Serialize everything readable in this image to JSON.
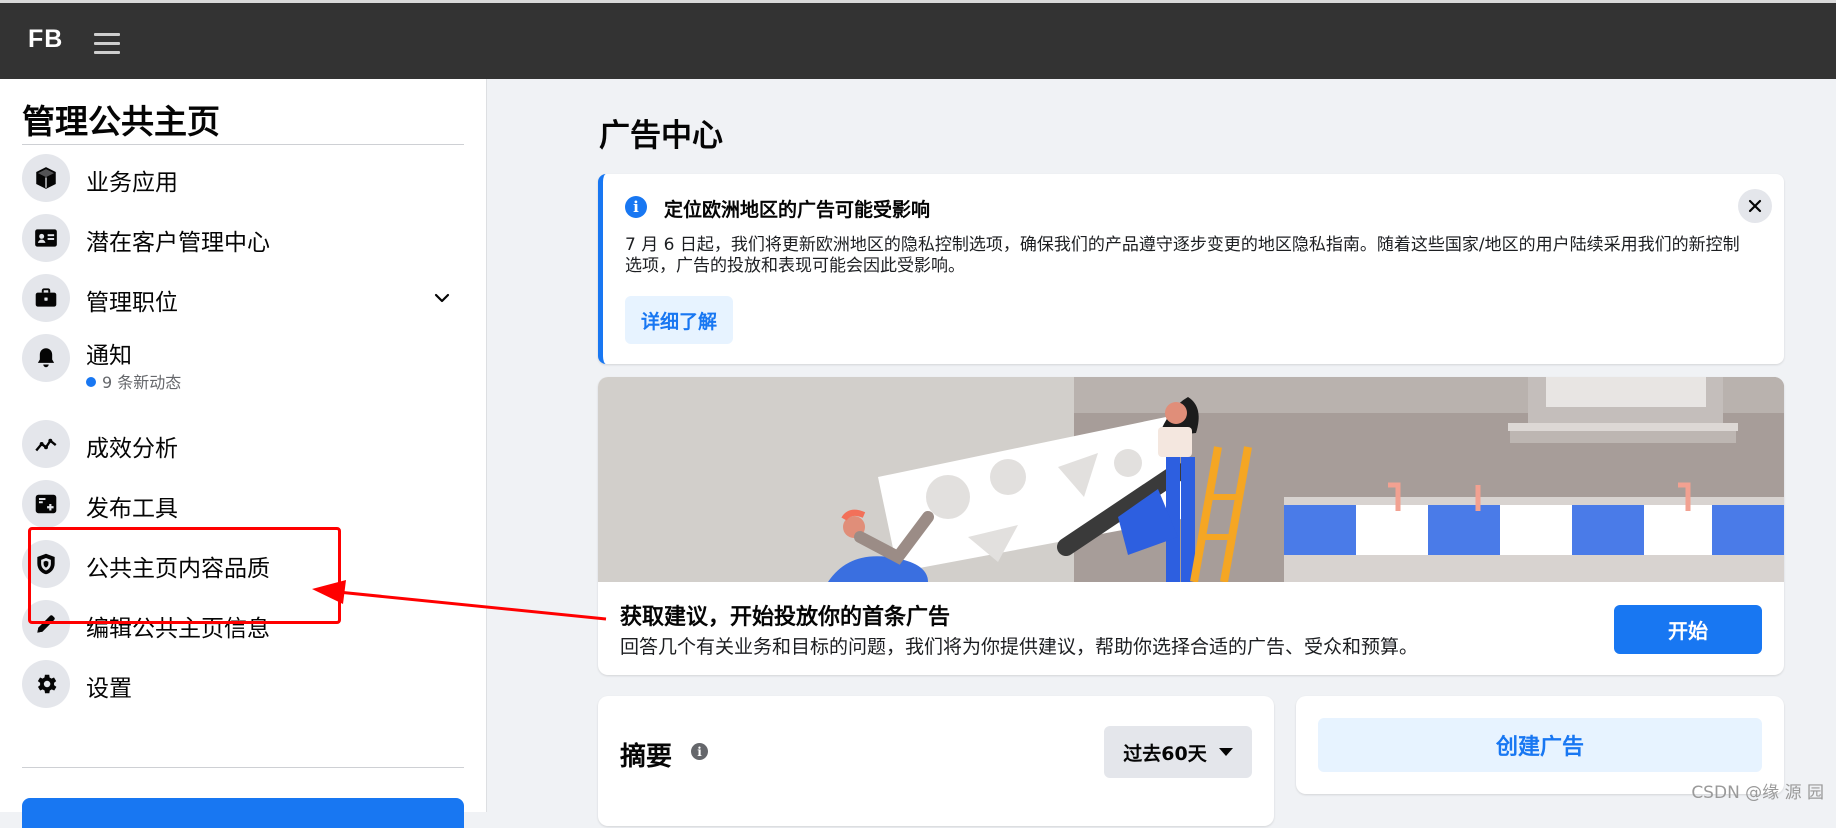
{
  "topbar": {
    "logo": "FB"
  },
  "sidebar": {
    "title": "管理公共主页",
    "items": [
      {
        "label": "业务应用",
        "icon": "cube-icon"
      },
      {
        "label": "潜在客户管理中心",
        "icon": "contact-card-icon"
      },
      {
        "label": "管理职位",
        "icon": "briefcase-icon",
        "expandable": true
      },
      {
        "label": "通知",
        "icon": "bell-icon",
        "sub": "9 条新动态"
      },
      {
        "label": "成效分析",
        "icon": "trend-chart-icon"
      },
      {
        "label": "发布工具",
        "icon": "publishing-tools-icon"
      },
      {
        "label": "公共主页内容品质",
        "icon": "shield-icon"
      },
      {
        "label": "编辑公共主页信息",
        "icon": "pencil-icon"
      },
      {
        "label": "设置",
        "icon": "gear-icon"
      }
    ]
  },
  "main": {
    "title": "广告中心",
    "notice": {
      "title": "定位欧洲地区的广告可能受影响",
      "body": "7 月 6 日起，我们将更新欧洲地区的隐私控制选项，确保我们的产品遵守逐步变更的地区隐私指南。随着这些国家/地区的用户陆续采用我们的新控制选项，广告的投放和表现可能会因此受影响。",
      "button": "详细了解"
    },
    "promo": {
      "title": "获取建议，开始投放你的首条广告",
      "body": "回答几个有关业务和目标的问题，我们将为你提供建议，帮助你选择合适的广告、受众和预算。",
      "button": "开始"
    },
    "summary": {
      "title": "摘要",
      "range": "过去60天"
    },
    "create": {
      "button": "创建广告"
    }
  },
  "watermark": "CSDN @缘  源  园",
  "colors": {
    "accent": "#1877f2",
    "topbar": "#333333",
    "annotation": "#ff0000"
  }
}
